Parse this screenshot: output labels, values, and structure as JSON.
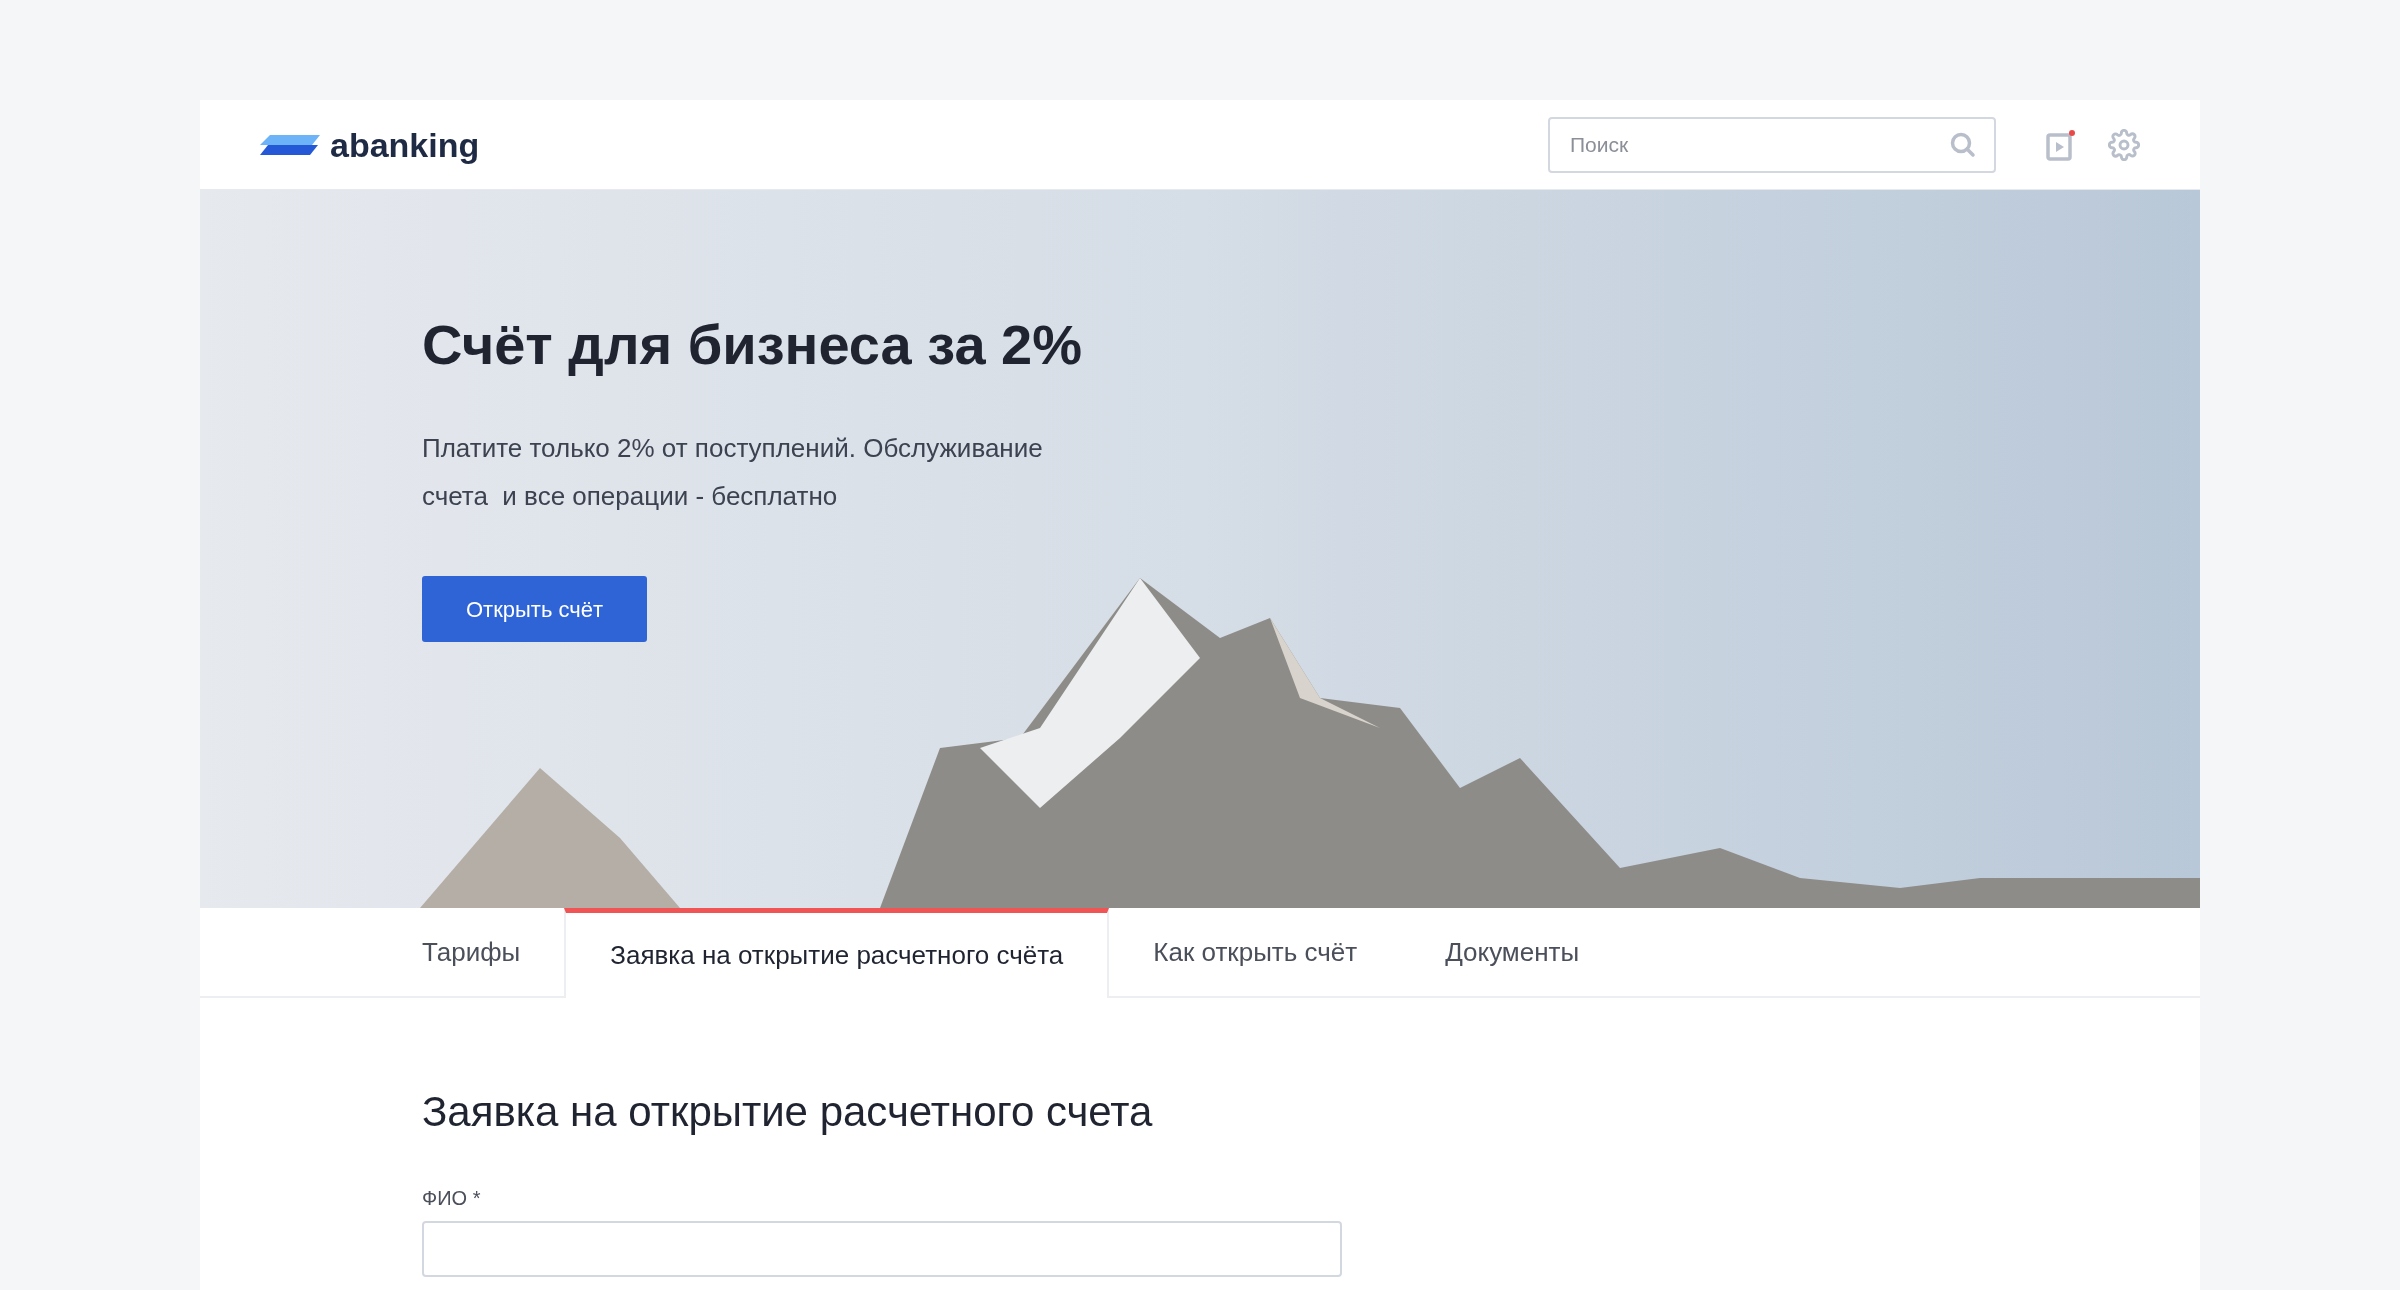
{
  "header": {
    "logo": "abanking",
    "search": {
      "placeholder": "Поиск"
    }
  },
  "hero": {
    "title": "Счёт для бизнеса за 2%",
    "subtitle": "Платите только 2% от поступлений. Обслуживание счета  и все операции - бесплатно",
    "button": "Открыть счёт"
  },
  "tabs": [
    {
      "label": "Тарифы",
      "selected": false
    },
    {
      "label": "Заявка на открытие расчетного счёта",
      "selected": true
    },
    {
      "label": "Как открыть счёт",
      "selected": false
    },
    {
      "label": "Документы",
      "selected": false
    }
  ],
  "form": {
    "title": "Заявка на открытие расчетного счета",
    "fields": [
      {
        "label": "ФИО *"
      }
    ]
  }
}
